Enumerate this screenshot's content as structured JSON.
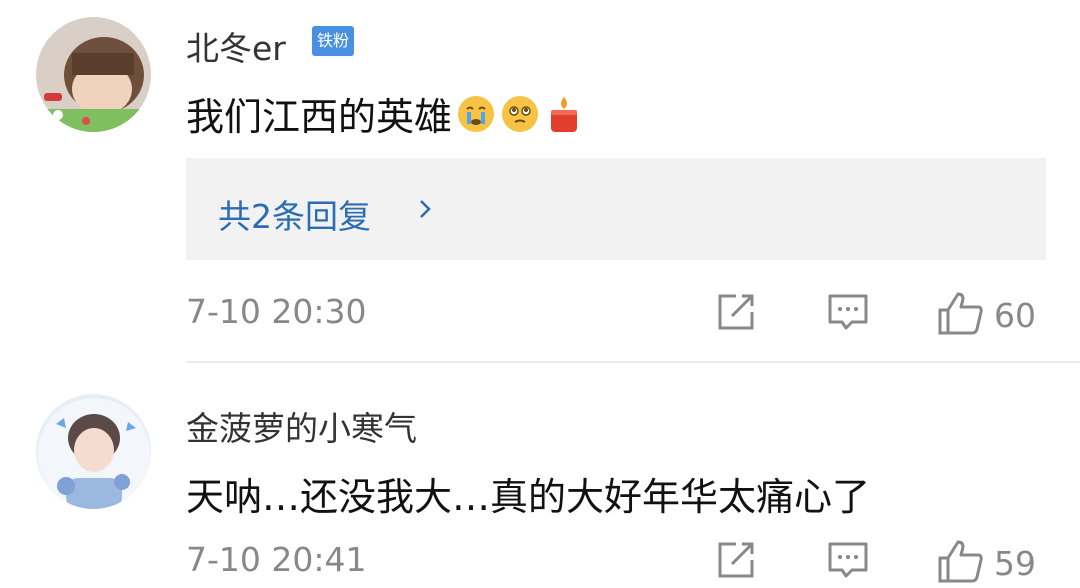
{
  "comments": [
    {
      "username": "北冬er",
      "badge": "铁粉",
      "text": "我们江西的英雄",
      "emojis": [
        "crying-face-icon",
        "pleading-face-icon",
        "candle-icon"
      ],
      "replies_label": "共2条回复",
      "timestamp": "7-10 20:30",
      "likes": "60"
    },
    {
      "username": "金菠萝的小寒气",
      "text": "天呐…还没我大…真的大好年华太痛心了",
      "timestamp": "7-10 20:41",
      "likes": "59"
    }
  ],
  "colors": {
    "badge": "#4a90e2",
    "link": "#2a6db3",
    "meta": "#888888",
    "reply_bg": "#f2f2f2"
  }
}
